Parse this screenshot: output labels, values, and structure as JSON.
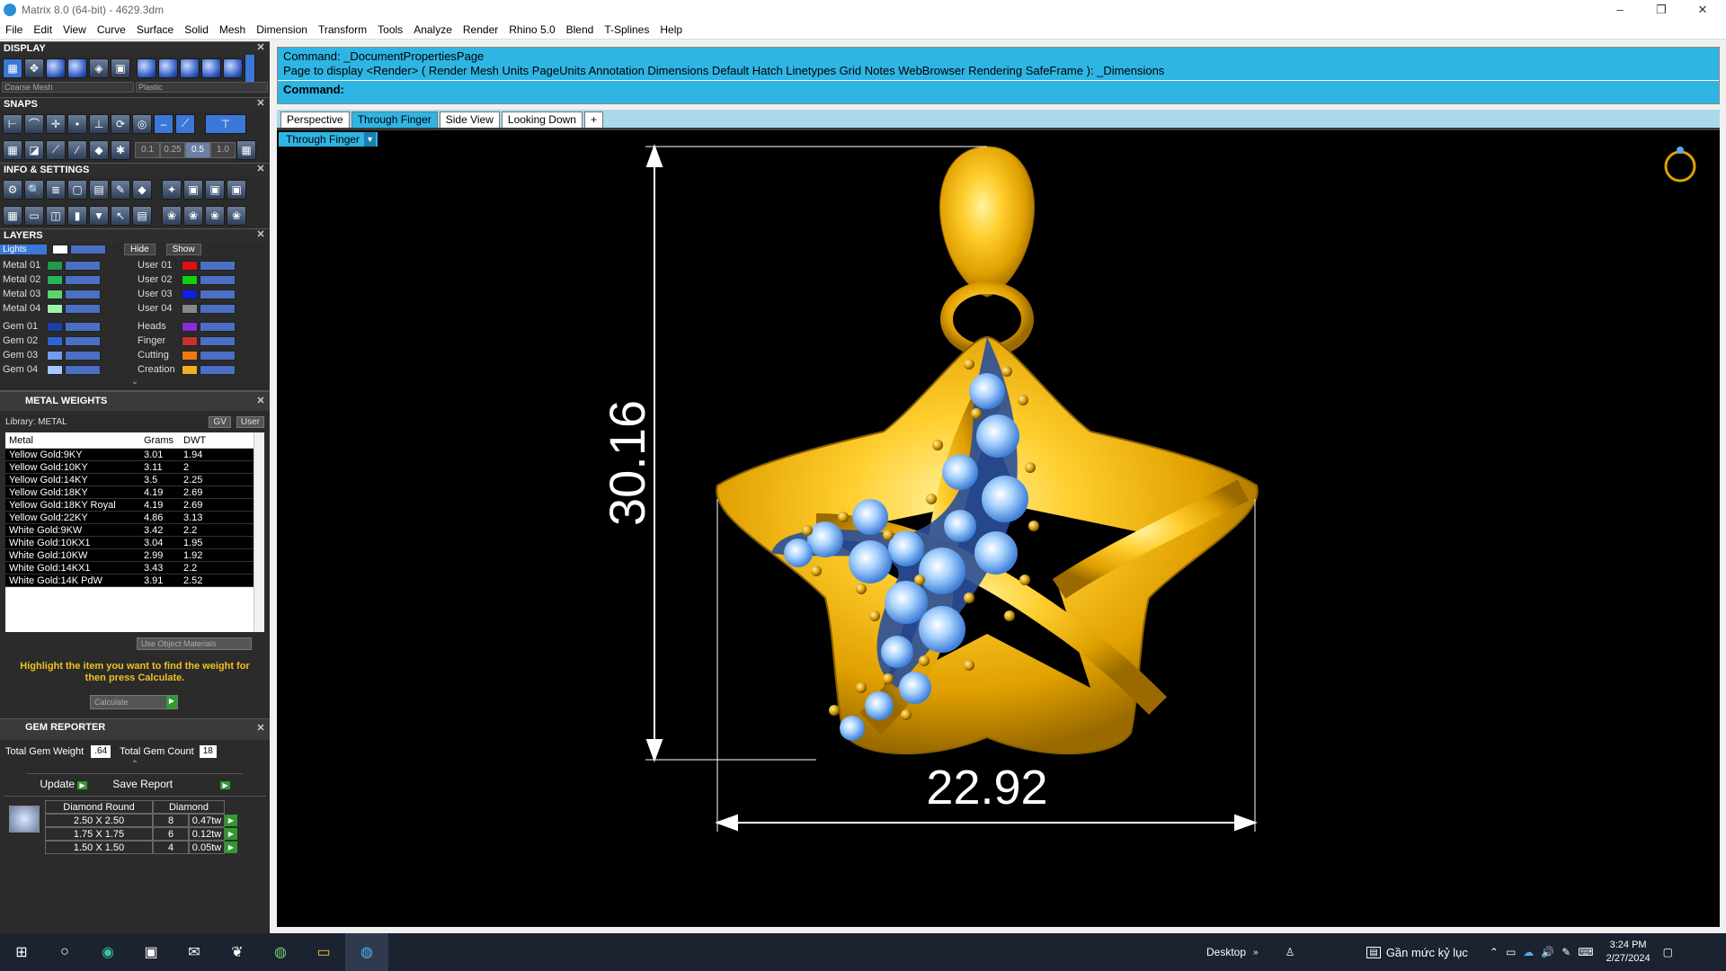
{
  "window": {
    "title": "Matrix 8.0 (64-bit) - 4629.3dm",
    "controls": {
      "minimize": "–",
      "maximize": "❐",
      "close": "✕"
    }
  },
  "menu": [
    "File",
    "Edit",
    "View",
    "Curve",
    "Surface",
    "Solid",
    "Mesh",
    "Dimension",
    "Transform",
    "Tools",
    "Analyze",
    "Render",
    "Rhino 5.0",
    "Blend",
    "T-Splines",
    "Help"
  ],
  "display": {
    "title": "DISPLAY",
    "mesh_select": "Coarse Mesh",
    "material_select": "Plastic"
  },
  "snaps": {
    "title": "SNAPS",
    "values": [
      "0.1",
      "0.25",
      "0.5",
      "1.0"
    ]
  },
  "info": {
    "title": "INFO & SETTINGS"
  },
  "layers": {
    "title": "LAYERS",
    "hide_label": "Hide",
    "show_label": "Show",
    "lights_label": "Lights",
    "left": [
      {
        "name": "Metal 01",
        "color": "#1f9a4a"
      },
      {
        "name": "Metal 02",
        "color": "#26b55a"
      },
      {
        "name": "Metal 03",
        "color": "#5ed46f"
      },
      {
        "name": "Metal 04",
        "color": "#9ff0a8"
      },
      {
        "name": "Gem 01",
        "color": "#1d3fa8"
      },
      {
        "name": "Gem 02",
        "color": "#2f63d8"
      },
      {
        "name": "Gem 03",
        "color": "#6f9cf0"
      },
      {
        "name": "Gem 04",
        "color": "#a8c6ff"
      }
    ],
    "right": [
      {
        "name": "User 01",
        "color": "#e01010"
      },
      {
        "name": "User 02",
        "color": "#10d010"
      },
      {
        "name": "User 03",
        "color": "#1020e0"
      },
      {
        "name": "User 04",
        "color": "#888888"
      },
      {
        "name": "Heads",
        "color": "#8a2ad8"
      },
      {
        "name": "Finger",
        "color": "#c83030"
      },
      {
        "name": "Cutting",
        "color": "#f07810"
      },
      {
        "name": "Creation",
        "color": "#f0b020"
      }
    ]
  },
  "metal_weights": {
    "title": "METAL WEIGHTS",
    "library": "Library: METAL",
    "gv": "GV",
    "user": "User",
    "headers": [
      "Metal",
      "Grams",
      "DWT"
    ],
    "rows": [
      [
        "Yellow Gold:9KY",
        "3.01",
        "1.94"
      ],
      [
        "Yellow Gold:10KY",
        "3.11",
        "2"
      ],
      [
        "Yellow Gold:14KY",
        "3.5",
        "2.25"
      ],
      [
        "Yellow Gold:18KY",
        "4.19",
        "2.69"
      ],
      [
        "Yellow Gold:18KY Royal",
        "4.19",
        "2.69"
      ],
      [
        "Yellow Gold:22KY",
        "4.86",
        "3.13"
      ],
      [
        "White Gold:9KW",
        "3.42",
        "2.2"
      ],
      [
        "White Gold:10KX1",
        "3.04",
        "1.95"
      ],
      [
        "White Gold:10KW",
        "2.99",
        "1.92"
      ],
      [
        "White Gold:14KX1",
        "3.43",
        "2.2"
      ],
      [
        "White Gold:14K PdW",
        "3.91",
        "2.52"
      ]
    ],
    "use_object_materials": "Use Object Materials",
    "hint": "Highlight the item you want to find the weight for then press Calculate.",
    "calculate": "Calculate"
  },
  "gem_reporter": {
    "title": "GEM REPORTER",
    "total_weight_label": "Total Gem Weight",
    "total_weight": ".64",
    "total_count_label": "Total Gem Count",
    "total_count": "18",
    "update": "Update",
    "save_report": "Save Report",
    "col1": "Diamond Round",
    "col2": "Diamond",
    "rows": [
      [
        "2.50 X 2.50",
        "8",
        "0.47tw"
      ],
      [
        "1.75 X 1.75",
        "6",
        "0.12tw"
      ],
      [
        "1.50 X 1.50",
        "4",
        "0.05tw"
      ]
    ]
  },
  "command": {
    "line1": "Command: _DocumentPropertiesPage",
    "line2": "Page to display <Render> ( Render  Mesh  Units  PageUnits  Annotation  Dimensions  Default  Hatch  Linetypes  Grid  Notes  WebBrowser  Rendering  SafeFrame ): _Dimensions",
    "prompt": "Command:"
  },
  "tabs": [
    "Perspective",
    "Through Finger",
    "Side View",
    "Looking Down",
    "+"
  ],
  "active_tab": "Through Finger",
  "viewport": {
    "label": "Through Finger",
    "dim_height": "30.16",
    "dim_width": "22.92"
  },
  "taskbar": {
    "desktop": "Desktop",
    "lang": "Gần mức kỷ lục",
    "time": "3:24 PM",
    "date": "2/27/2024"
  }
}
